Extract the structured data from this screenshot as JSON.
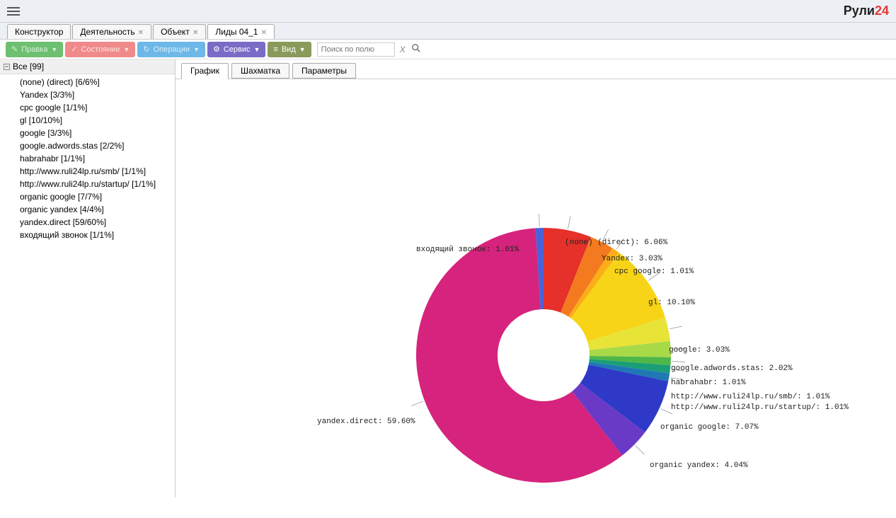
{
  "brand": {
    "part1": "Рули",
    "part2": "24"
  },
  "tabs": [
    {
      "label": "Конструктор",
      "closable": false,
      "active": false
    },
    {
      "label": "Деятельность",
      "closable": true,
      "active": false
    },
    {
      "label": "Объект",
      "closable": true,
      "active": false
    },
    {
      "label": "Лиды 04_1",
      "closable": true,
      "active": true
    }
  ],
  "toolbar": {
    "edit": "Правка",
    "state": "Состояние",
    "ops": "Операции",
    "service": "Сервис",
    "view": "Вид",
    "search_placeholder": "Поиск по полю"
  },
  "tree": {
    "root": "Все [99]",
    "items": [
      "(none) (direct) [6/6%]",
      "Yandex [3/3%]",
      "cpc google [1/1%]",
      "gl [10/10%]",
      "google [3/3%]",
      "google.adwords.stas [2/2%]",
      "habrahabr [1/1%]",
      "http://www.ruli24lp.ru/smb/ [1/1%]",
      "http://www.ruli24lp.ru/startup/ [1/1%]",
      "organic google [7/7%]",
      "organic yandex [4/4%]",
      "yandex.direct [59/60%]",
      "входящий звонок [1/1%]"
    ]
  },
  "subtabs": {
    "chart": "График",
    "chess": "Шахматка",
    "params": "Параметры"
  },
  "chart_data": {
    "type": "pie",
    "title": "",
    "series": [
      {
        "name": "(none) (direct)",
        "value": 6.06,
        "color": "#e6302a",
        "label": "(none) (direct): 6.06%"
      },
      {
        "name": "Yandex",
        "value": 3.03,
        "color": "#f47a1f",
        "label": "Yandex: 3.03%"
      },
      {
        "name": "cpc google",
        "value": 1.01,
        "color": "#fbae17",
        "label": "cpc google: 1.01%"
      },
      {
        "name": "gl",
        "value": 10.1,
        "color": "#f7d417",
        "label": "gl: 10.10%"
      },
      {
        "name": "google",
        "value": 3.03,
        "color": "#e8e337",
        "label": "google: 3.03%"
      },
      {
        "name": "google.adwords.stas",
        "value": 2.02,
        "color": "#a8d948",
        "label": "google.adwords.stas: 2.02%"
      },
      {
        "name": "habrahabr",
        "value": 1.01,
        "color": "#4eb748",
        "label": "habrahabr: 1.01%"
      },
      {
        "name": "http://www.ruli24lp.ru/smb/",
        "value": 1.01,
        "color": "#1b9e77",
        "label": "http://www.ruli24lp.ru/smb/: 1.01%"
      },
      {
        "name": "http://www.ruli24lp.ru/startup/",
        "value": 1.01,
        "color": "#1f78b4",
        "label": "http://www.ruli24lp.ru/startup/: 1.01%"
      },
      {
        "name": "organic google",
        "value": 7.07,
        "color": "#2e3ac7",
        "label": "organic google: 7.07%"
      },
      {
        "name": "organic yandex",
        "value": 4.04,
        "color": "#6a3ac7",
        "label": "organic yandex: 4.04%"
      },
      {
        "name": "yandex.direct",
        "value": 59.6,
        "color": "#d6237d",
        "label": "yandex.direct: 59.60%"
      },
      {
        "name": "входящий звонок",
        "value": 1.01,
        "color": "#4a62d8",
        "label": "входящий звонок: 1.01%"
      }
    ]
  }
}
